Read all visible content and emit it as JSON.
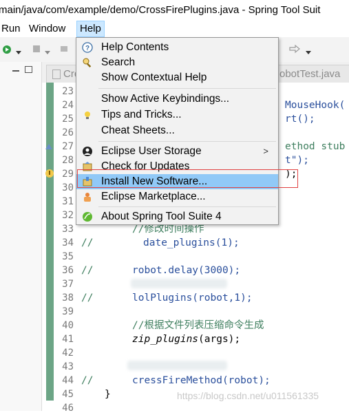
{
  "window": {
    "title": "main/java/com/example/demo/CrossFirePlugins.java - Spring Tool Suit"
  },
  "menubar": {
    "items": [
      "Run",
      "Window",
      "Help"
    ]
  },
  "tabs": {
    "left_tab": "Cro",
    "right_tab": "obotTest.java"
  },
  "help_menu": {
    "items": [
      {
        "label": "Help Contents",
        "icon": "help-contents-icon"
      },
      {
        "label": "Search",
        "icon": "search-icon"
      },
      {
        "label": "Show Contextual Help",
        "icon": ""
      },
      {
        "label": "Show Active Keybindings...",
        "icon": ""
      },
      {
        "label": "Tips and Tricks...",
        "icon": "tips-icon"
      },
      {
        "label": "Cheat Sheets...",
        "icon": ""
      },
      {
        "label": "Eclipse User Storage",
        "icon": "user-storage-icon",
        "submenu": true
      },
      {
        "label": "Check for Updates",
        "icon": "check-updates-icon"
      },
      {
        "label": "Install New Software...",
        "icon": "install-software-icon",
        "highlighted": true
      },
      {
        "label": "Eclipse Marketplace...",
        "icon": "marketplace-icon"
      },
      {
        "label": "About Spring Tool Suite 4",
        "icon": "spring-icon"
      }
    ]
  },
  "editor": {
    "line_numbers": [
      "23",
      "24",
      "25",
      "26",
      "27",
      "28",
      "29",
      "30",
      "31",
      "32",
      "33",
      "34",
      "35",
      "36",
      "37",
      "38",
      "39",
      "40",
      "41",
      "42",
      "43",
      "44",
      "45",
      "46"
    ],
    "visible_fragments": {
      "l24": "MouseHook(",
      "l25": "rt();",
      "l27": "ethod stub",
      "l28": "t\");",
      "l29": ");",
      "l33": "//修改时间操作",
      "l34_prefix": "//",
      "l34": "date_plugins(1);",
      "l36_prefix": "//",
      "l36": "robot.delay(3000);",
      "l38_prefix": "//",
      "l38": "lolPlugins(robot,1);",
      "l40": "//根据文件列表压缩命令生成",
      "l41_fn": "zip_plugins",
      "l41_rest": "(args);",
      "l44_prefix": "//",
      "l44": "cressFireMethod(robot);",
      "l45": "}"
    }
  },
  "watermark": "https://blog.csdn.net/u011561335",
  "colors": {
    "menu_highlight": "#91c9f7",
    "annotation_box": "#e04040",
    "gutter_green": "#6ca586"
  }
}
